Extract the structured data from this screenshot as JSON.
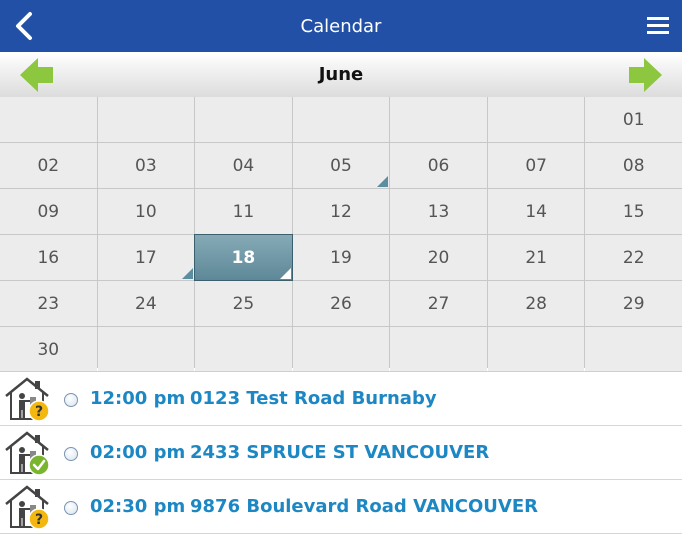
{
  "header": {
    "title": "Calendar",
    "color": "#2150a6"
  },
  "month_bar": {
    "month": "June"
  },
  "calendar": {
    "days": [
      "",
      "",
      "",
      "",
      "",
      "",
      "01",
      "02",
      "03",
      "04",
      "05",
      "06",
      "07",
      "08",
      "09",
      "10",
      "11",
      "12",
      "13",
      "14",
      "15",
      "16",
      "17",
      "18",
      "19",
      "20",
      "21",
      "22",
      "23",
      "24",
      "25",
      "26",
      "27",
      "28",
      "29",
      "30",
      "",
      "",
      "",
      "",
      "",
      ""
    ],
    "selected_day": "18",
    "days_with_events": [
      "05",
      "17",
      "18"
    ]
  },
  "appointments": [
    {
      "time": "12:00 pm",
      "address": "0123 Test Road Burnaby",
      "status": "pending",
      "status_icon": "question-badge-icon"
    },
    {
      "time": "02:00 pm",
      "address": "2433 SPRUCE ST VANCOUVER",
      "status": "confirmed",
      "status_icon": "checkmark-badge-icon"
    },
    {
      "time": "02:30 pm",
      "address": "9876 Boulevard Road VANCOUVER",
      "status": "pending",
      "status_icon": "question-badge-icon"
    }
  ],
  "colors": {
    "link_blue": "#1d87c4",
    "arrow_green": "#8dc63f",
    "pending_yellow": "#f2b80f",
    "confirmed_green": "#7ab52f"
  }
}
